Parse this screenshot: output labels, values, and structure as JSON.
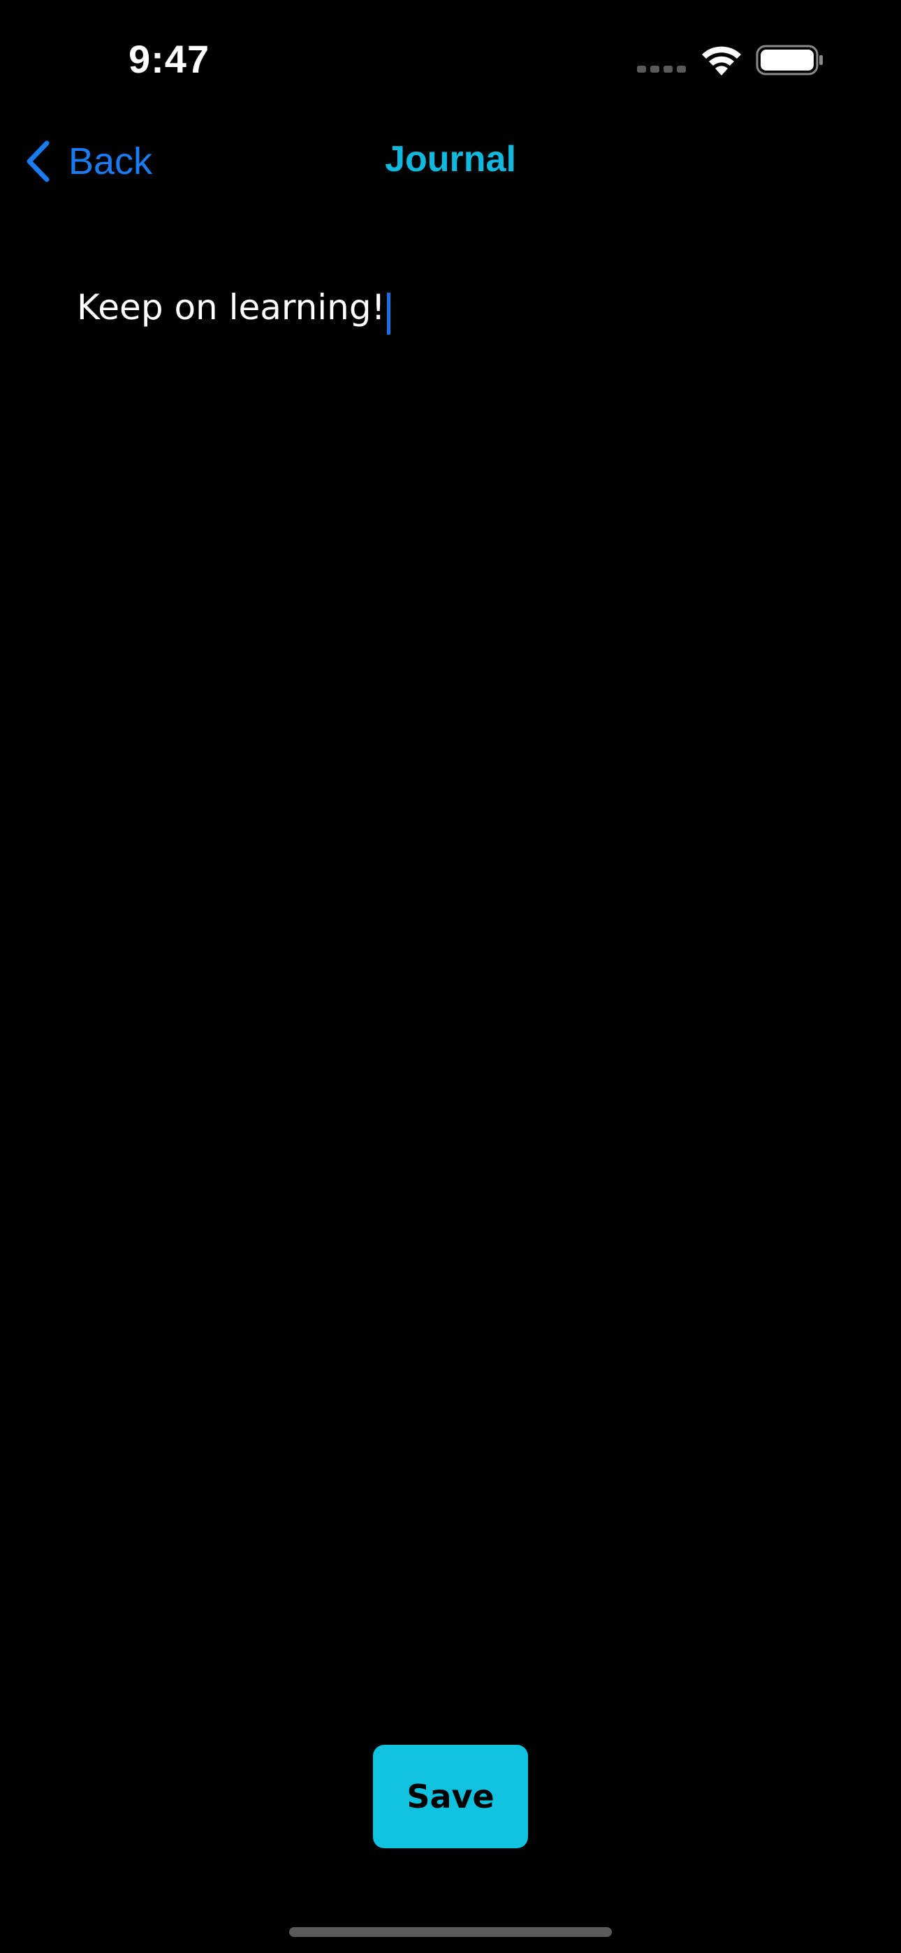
{
  "status_bar": {
    "time": "9:47",
    "icons": [
      "signal-icon",
      "wifi-icon",
      "battery-icon"
    ]
  },
  "nav": {
    "back_label": "Back",
    "title": "Journal"
  },
  "editor": {
    "text": "Keep on learning!"
  },
  "actions": {
    "save_label": "Save"
  },
  "colors": {
    "background": "#000000",
    "back_link": "#1a7cf0",
    "title": "#11b8dd",
    "save_button": "#0fc3e0",
    "caret": "#1a6ee8"
  }
}
